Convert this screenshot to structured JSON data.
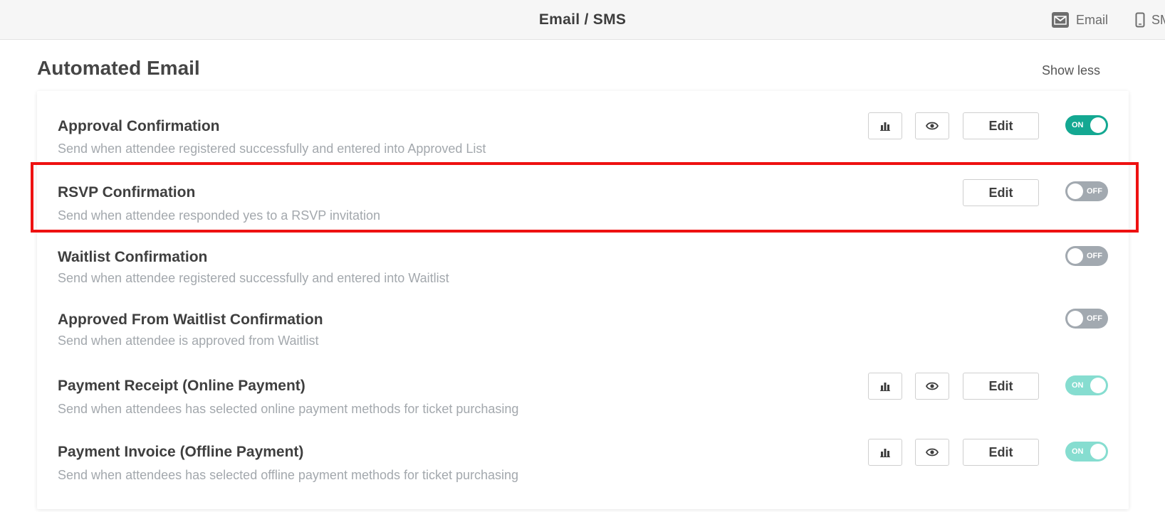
{
  "header": {
    "title": "Email / SMS",
    "tabs": [
      {
        "label": "Email",
        "icon": "envelope-icon"
      },
      {
        "label": "SMS",
        "icon": "mobile-phone-icon"
      }
    ]
  },
  "section": {
    "title": "Automated Email",
    "toggle_view_label": "Show less"
  },
  "colors": {
    "toggle_on": "#14a892",
    "toggle_on_faded": "#86ddd0",
    "toggle_off": "#a2a9b0",
    "highlight": "#ee1111"
  },
  "emails": [
    {
      "title": "Approval Confirmation",
      "description": "Send when attendee registered successfully and entered into Approved List",
      "edit_label": "Edit",
      "toggle_label": "ON",
      "enabled": true
    },
    {
      "title": "RSVP Confirmation",
      "description": "Send when attendee responded yes to a RSVP invitation",
      "edit_label": "Edit",
      "toggle_label": "OFF",
      "enabled": false,
      "highlighted": true
    },
    {
      "title": "Waitlist Confirmation",
      "description": "Send when attendee registered successfully and entered into Waitlist",
      "toggle_label": "OFF",
      "enabled": false
    },
    {
      "title": "Approved From Waitlist Confirmation",
      "description": "Send when attendee is approved from Waitlist",
      "toggle_label": "OFF",
      "enabled": false
    },
    {
      "title": "Payment Receipt (Online Payment)",
      "description": "Send when attendees has selected online payment methods for ticket purchasing",
      "edit_label": "Edit",
      "toggle_label": "ON",
      "enabled": true
    },
    {
      "title": "Payment Invoice (Offline Payment)",
      "description": "Send when attendees has selected offline payment methods for ticket purchasing",
      "edit_label": "Edit",
      "toggle_label": "ON",
      "enabled": true
    }
  ]
}
